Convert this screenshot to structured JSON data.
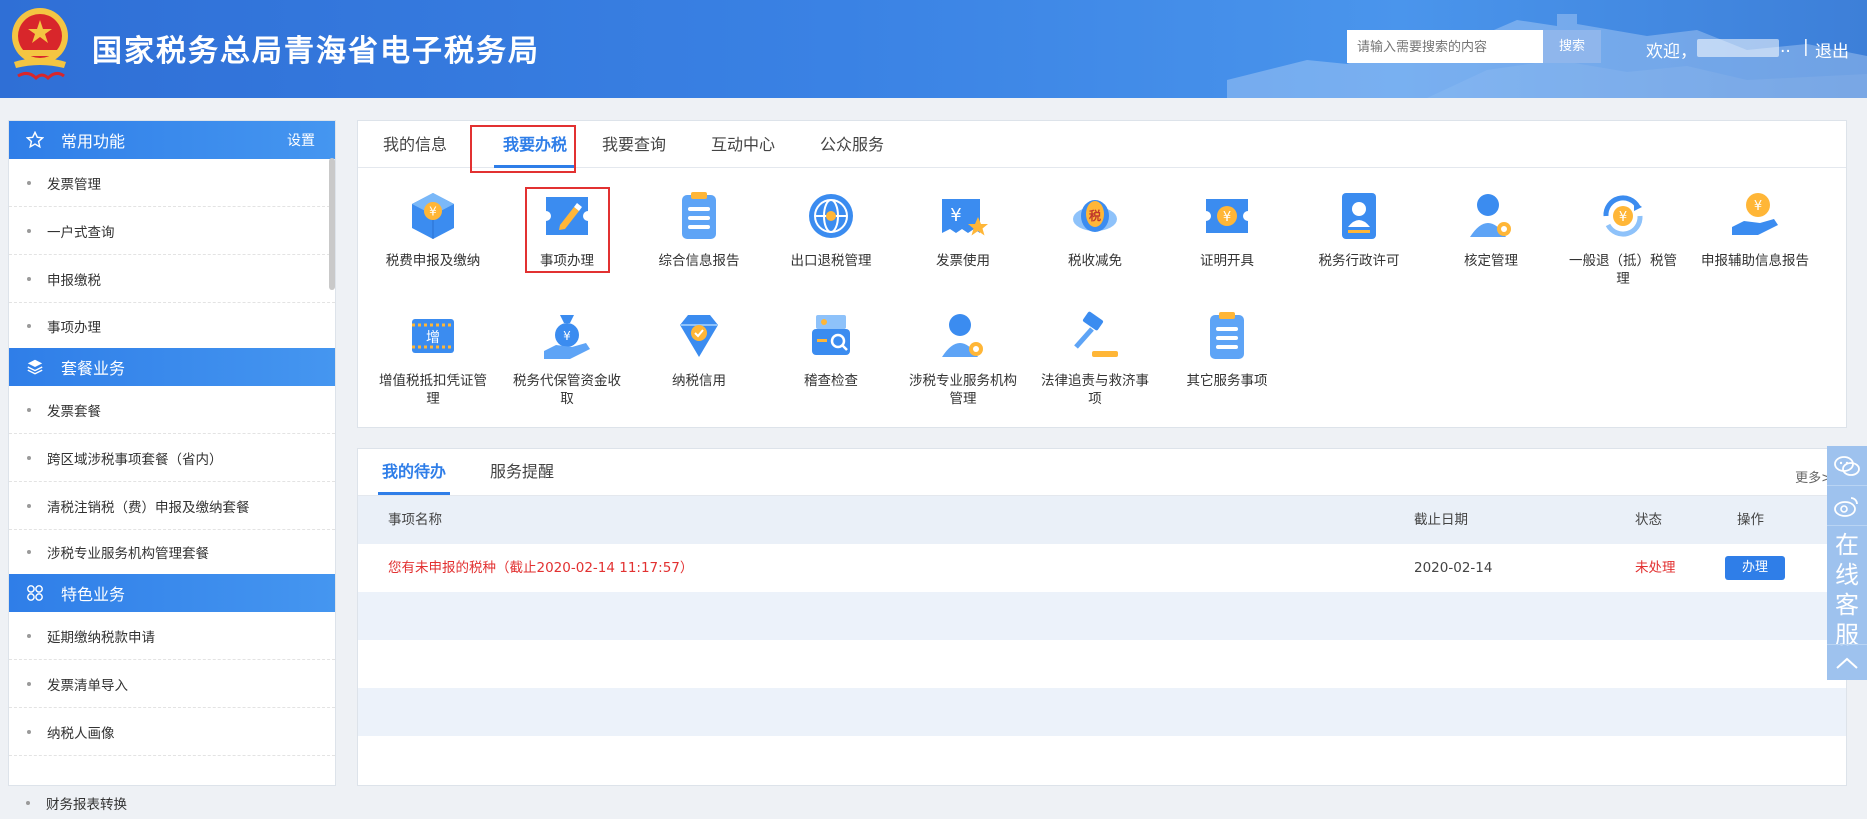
{
  "header": {
    "title": "国家税务总局青海省电子税务局",
    "search_placeholder": "请输入需要搜索的内容",
    "search_button": "搜索",
    "welcome": "欢迎，",
    "welcome_tail": "..",
    "separator": "|",
    "logout": "退出"
  },
  "sidebar": {
    "sections": [
      {
        "title": "常用功能",
        "setting": "设置",
        "items": [
          "发票管理",
          "一户式查询",
          "申报缴税",
          "事项办理"
        ]
      },
      {
        "title": "套餐业务",
        "items": [
          "发票套餐",
          "跨区域涉税事项套餐（省内）",
          "清税注销税（费）申报及缴纳套餐",
          "涉税专业服务机构管理套餐"
        ]
      },
      {
        "title": "特色业务",
        "items": [
          "延期缴纳税款申请",
          "发票清单导入",
          "纳税人画像",
          "财务报表转换"
        ]
      }
    ]
  },
  "main": {
    "tabs": [
      "我的信息",
      "我要办税",
      "我要查询",
      "互动中心",
      "公众服务"
    ],
    "active_tab": "我要办税",
    "functions": [
      {
        "label": "税费申报及缴纳",
        "icon": "tax-box-icon"
      },
      {
        "label": "事项办理",
        "icon": "edit-ticket-icon"
      },
      {
        "label": "综合信息报告",
        "icon": "clipboard-icon"
      },
      {
        "label": "出口退税管理",
        "icon": "globe-icon"
      },
      {
        "label": "发票使用",
        "icon": "invoice-icon"
      },
      {
        "label": "税收减免",
        "icon": "coins-icon"
      },
      {
        "label": "证明开具",
        "icon": "certificate-icon"
      },
      {
        "label": "税务行政许可",
        "icon": "license-icon"
      },
      {
        "label": "核定管理",
        "icon": "user-gear-icon"
      },
      {
        "label": "一般退（抵）税管理",
        "icon": "refund-icon"
      },
      {
        "label": "申报辅助信息报告",
        "icon": "hand-coin-icon"
      },
      {
        "label": "增值税抵扣凭证管理",
        "icon": "vat-ticket-icon"
      },
      {
        "label": "税务代保管资金收取",
        "icon": "money-bag-icon"
      },
      {
        "label": "纳税信用",
        "icon": "credit-diamond-icon"
      },
      {
        "label": "稽查检查",
        "icon": "inspection-icon"
      },
      {
        "label": "涉税专业服务机构管理",
        "icon": "agent-gear-icon"
      },
      {
        "label": "法律追责与救济事项",
        "icon": "gavel-icon"
      },
      {
        "label": "其它服务事项",
        "icon": "list-icon"
      }
    ]
  },
  "todo": {
    "tabs": [
      "我的待办",
      "服务提醒"
    ],
    "more": "更多>",
    "columns": [
      "事项名称",
      "截止日期",
      "状态",
      "操作"
    ],
    "rows": [
      {
        "name": "您有未申报的税种（截止2020-02-14 11:17:57）",
        "date": "2020-02-14",
        "status": "未处理",
        "action": "办理"
      }
    ]
  },
  "float": {
    "service_text": "在线客服"
  },
  "colors": {
    "primary": "#2f7ee8",
    "alert": "#e23131",
    "header": "#3a82e4"
  }
}
